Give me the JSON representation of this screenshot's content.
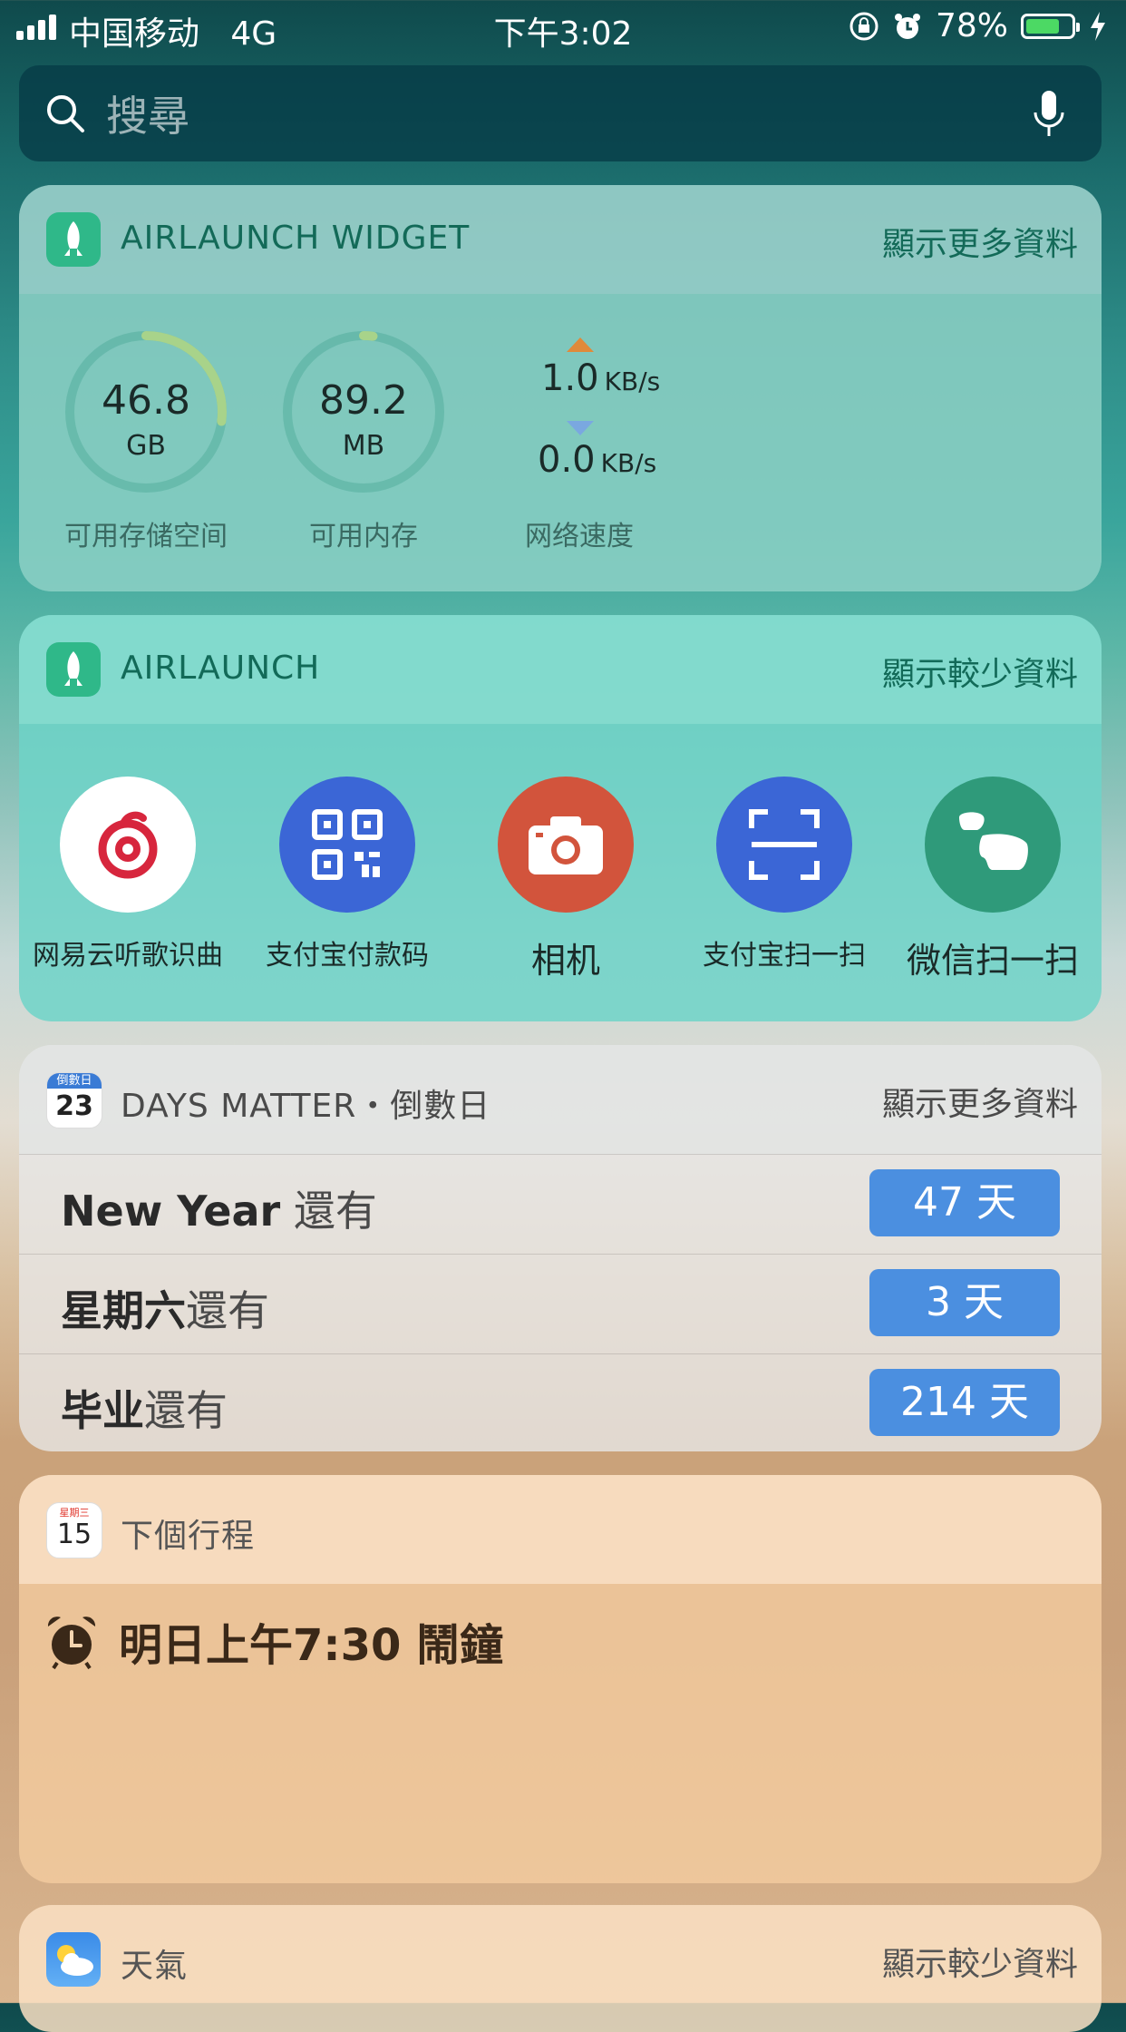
{
  "status": {
    "carrier": "中国移动",
    "network": "4G",
    "time": "下午3:02",
    "battery": "78%",
    "battery_level": 0.78
  },
  "search": {
    "placeholder": "搜尋"
  },
  "widget1": {
    "title": "AIRLAUNCH WIDGET",
    "more": "顯示更多資料",
    "storage": {
      "value": "46.8",
      "unit": "GB",
      "label": "可用存储空间",
      "level": 0.27
    },
    "memory": {
      "value": "89.2",
      "unit": "MB",
      "label": "可用内存",
      "level": 0.02
    },
    "network": {
      "up": "1.0",
      "down": "0.0",
      "unit": "KB/s",
      "label": "网络速度"
    }
  },
  "widget2": {
    "title": "AIRLAUNCH",
    "more": "顯示較少資料",
    "apps": [
      {
        "label": "网易云听歌识曲",
        "icon": "netease-music-icon",
        "color": "#ffffff"
      },
      {
        "label": "支付宝付款码",
        "icon": "qr-code-icon",
        "color": "#3b66d6"
      },
      {
        "label": "相机",
        "icon": "camera-icon",
        "color": "#d2543c"
      },
      {
        "label": "支付宝扫一扫",
        "icon": "scan-icon",
        "color": "#3b66d6"
      },
      {
        "label": "微信扫一扫",
        "icon": "wechat-scan-icon",
        "color": "#2f9a7a"
      }
    ]
  },
  "days": {
    "icon_top": "倒數日",
    "icon_num": "23",
    "title": "DAYS MATTER・倒數日",
    "more": "顯示更多資料",
    "rows": [
      {
        "name": "New Year",
        "suffix": " 還有",
        "days": "47 天"
      },
      {
        "name": "星期六",
        "suffix": "還有",
        "days": "3 天"
      },
      {
        "name": "毕业",
        "suffix": "還有",
        "days": "214 天"
      }
    ]
  },
  "calendar": {
    "icon_top": "星期三",
    "icon_num": "15",
    "title": "下個行程",
    "event": "明日上午7:30 鬧鐘"
  },
  "weather": {
    "title": "天氣",
    "more": "顯示較少資料"
  }
}
